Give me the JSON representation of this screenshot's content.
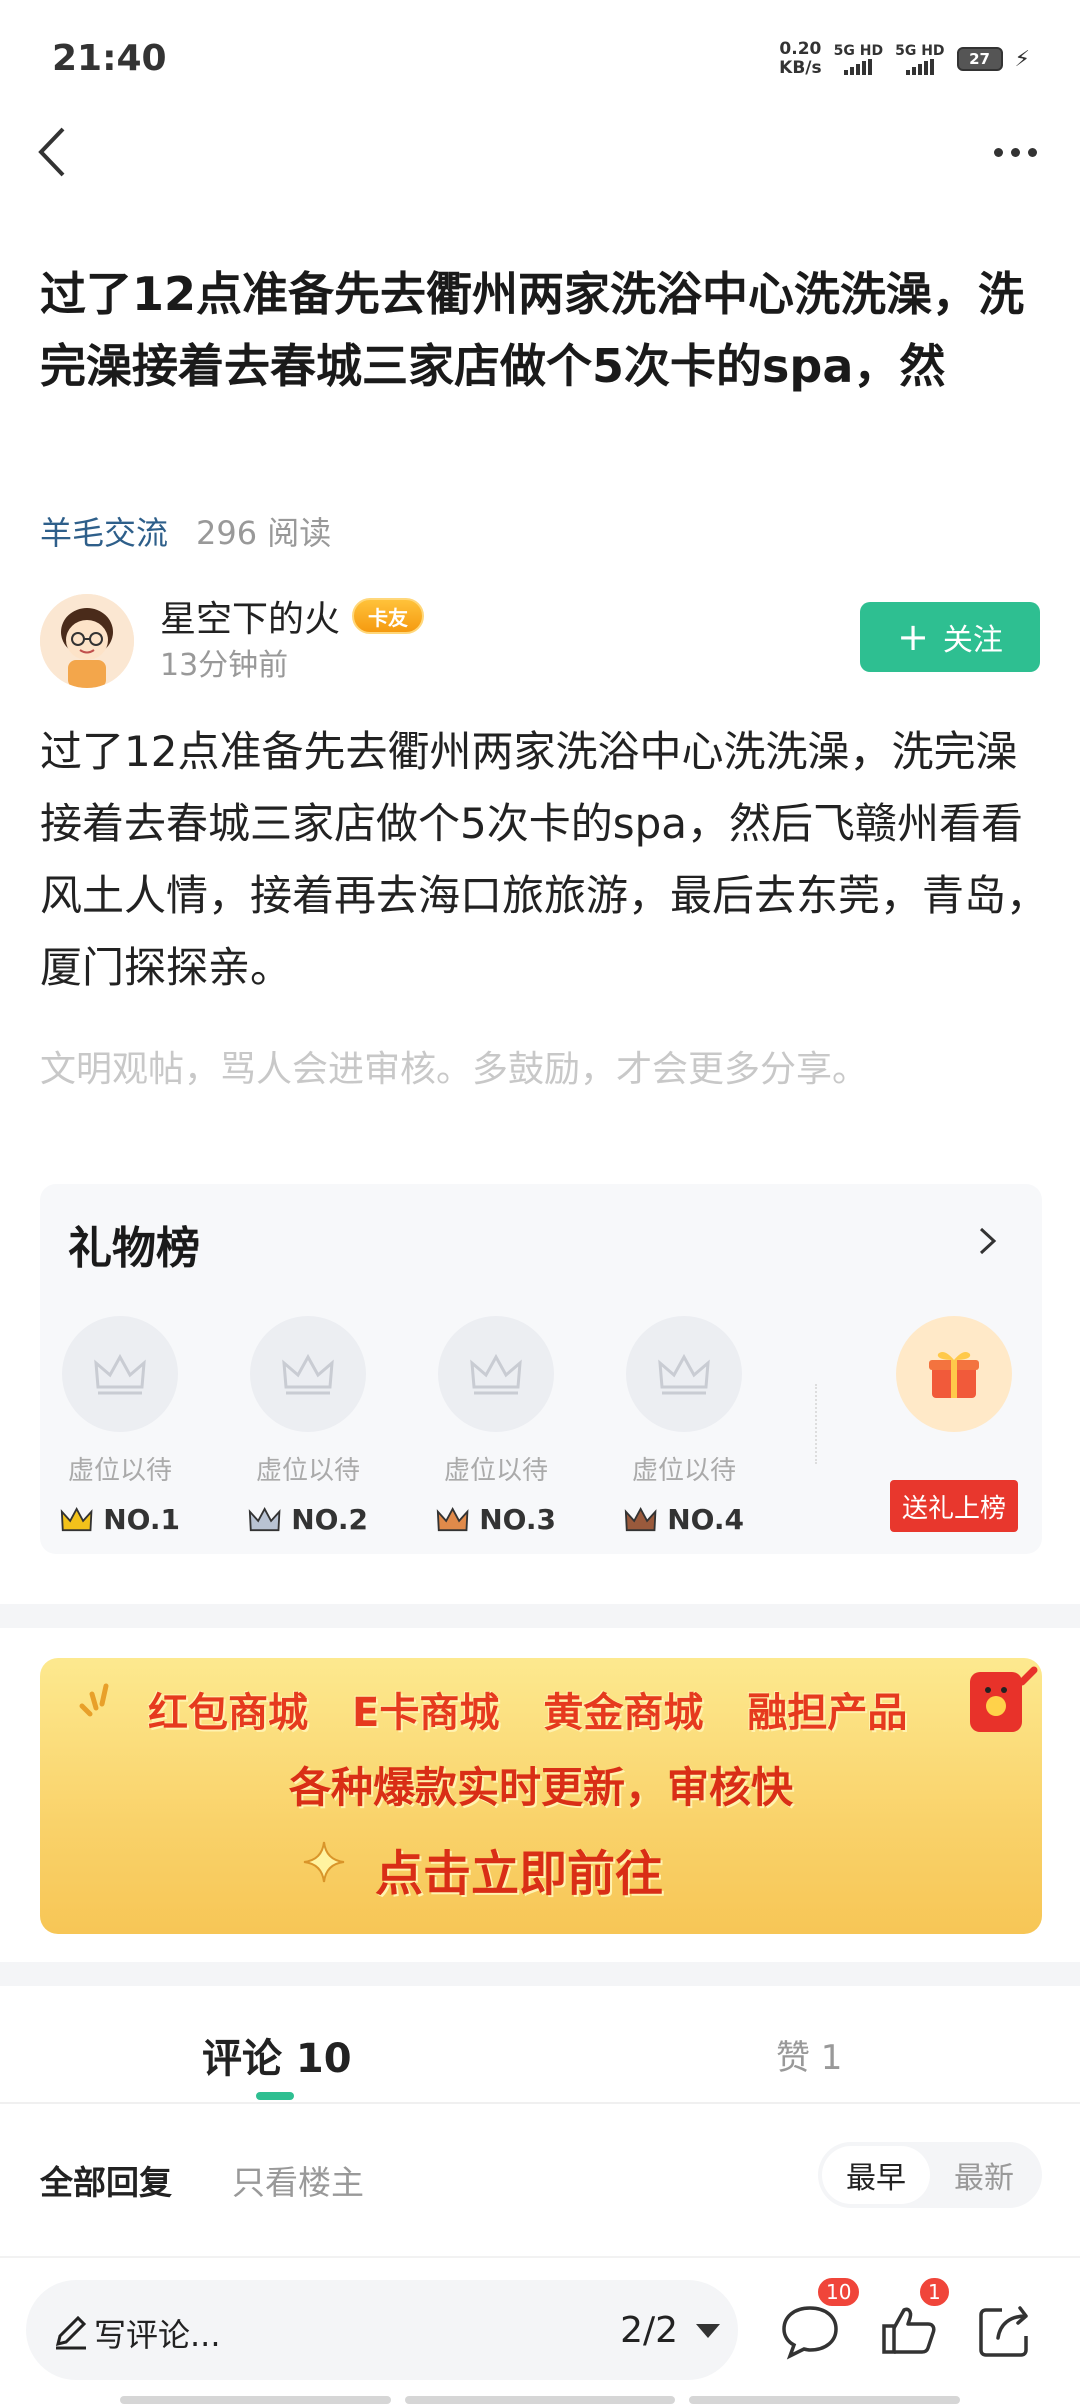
{
  "status_bar": {
    "time": "21:40",
    "net_speed_value": "0.20",
    "net_speed_unit": "KB/s",
    "sim1": "5G HD",
    "sim2": "5G HD",
    "battery": "27"
  },
  "post": {
    "title": "过了12点准备先去衢州两家洗浴中心洗洗澡，洗完澡接着去春城三家店做个5次卡的spa，然",
    "topic": "羊毛交流",
    "reads": "296 阅读",
    "author_name": "星空下的火",
    "author_badge": "卡友",
    "posted": "13分钟前",
    "follow_label": "关注",
    "body": "过了12点准备先去衢州两家洗浴中心洗洗澡，洗完澡接着去春城三家店做个5次卡的spa，然后飞赣州看看风土人情，接着再去海口旅旅游，最后去东莞，青岛，厦门探探亲。",
    "hint": "文明观帖，骂人会进审核。多鼓励，才会更多分享。"
  },
  "gift_board": {
    "title": "礼物榜",
    "slots": [
      {
        "label": "虚位以待",
        "rank": "NO.1",
        "crown_color": "#f2c21b"
      },
      {
        "label": "虚位以待",
        "rank": "NO.2",
        "crown_color": "#b9c3d3"
      },
      {
        "label": "虚位以待",
        "rank": "NO.3",
        "crown_color": "#e08a4a"
      },
      {
        "label": "虚位以待",
        "rank": "NO.4",
        "crown_color": "#9a5a3c"
      }
    ],
    "send_label": "送礼上榜"
  },
  "banner": {
    "items": [
      "红包商城",
      "E卡商城",
      "黄金商城",
      "融担产品"
    ],
    "subtitle": "各种爆款实时更新，审核快",
    "cta": "点击立即前往"
  },
  "comments": {
    "tab_comments": "评论 10",
    "tab_likes": "赞 1",
    "filter_all": "全部回复",
    "filter_op": "只看楼主",
    "sort_earliest": "最早",
    "sort_latest": "最新"
  },
  "bottom_bar": {
    "write_placeholder": "写评论...",
    "page": "2/2",
    "comment_count": "10",
    "like_count": "1"
  },
  "colors": {
    "accent_green": "#2ebf91",
    "badge_red": "#f0453a",
    "topic_blue": "#2e5f8a"
  }
}
